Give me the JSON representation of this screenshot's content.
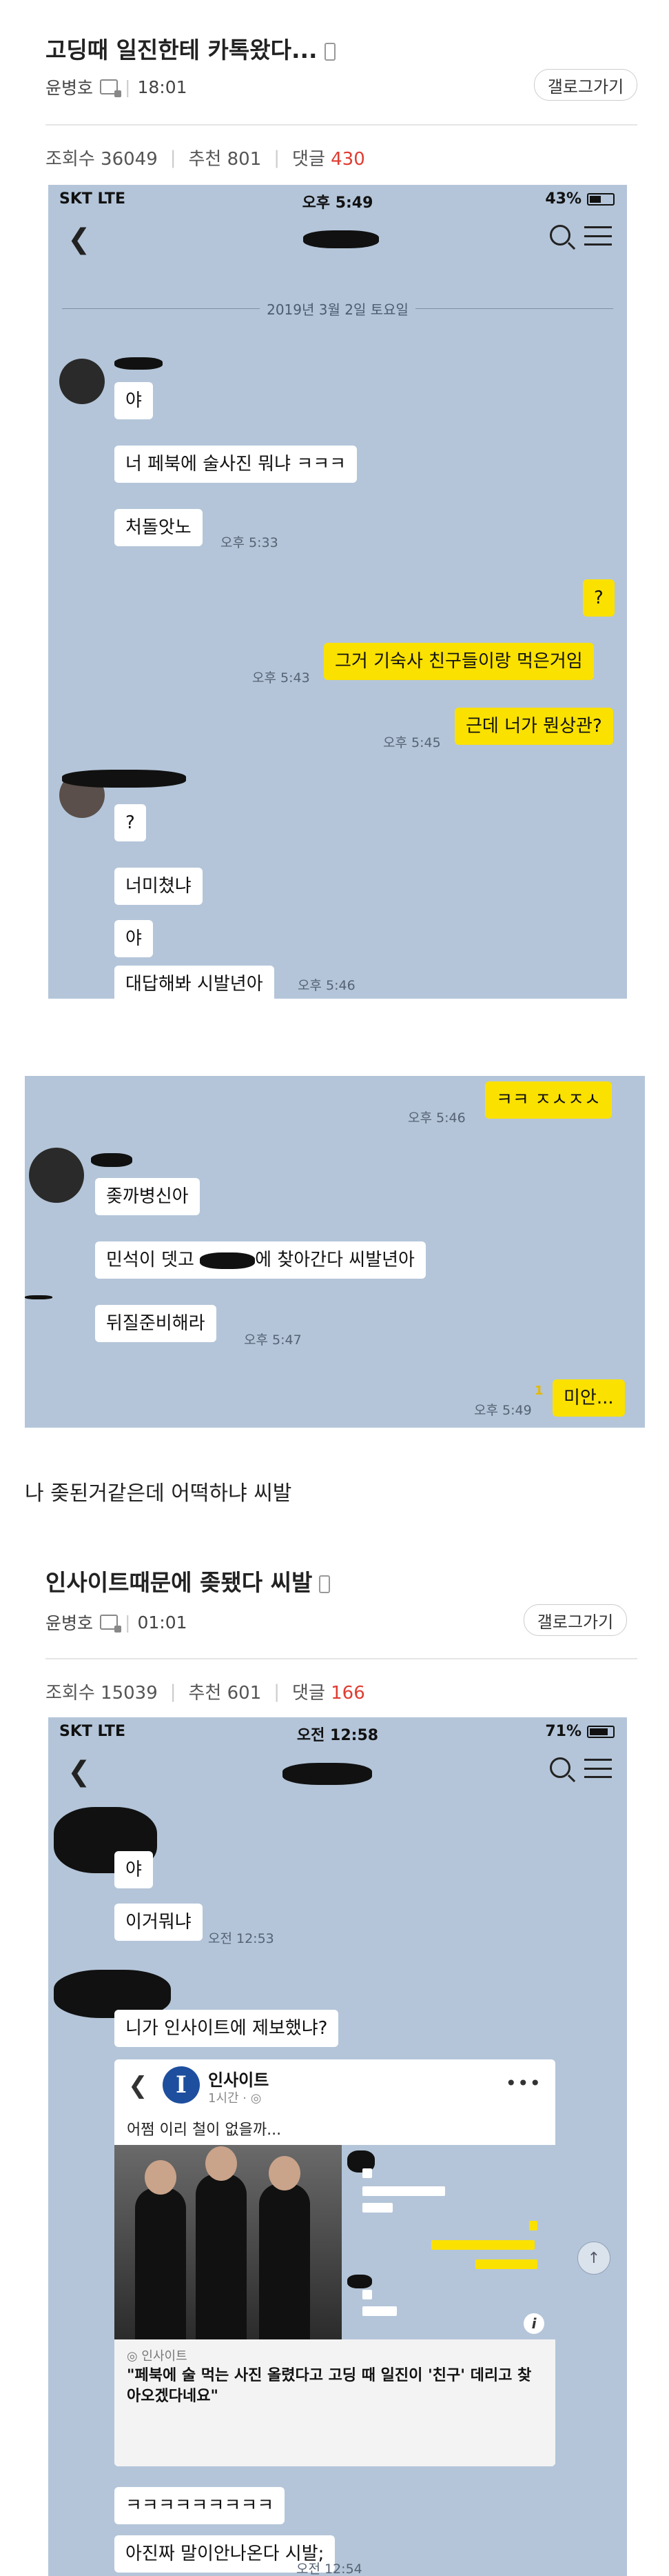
{
  "post1": {
    "title": "고딩때 일진한테 카톡왔다...",
    "author": "윤병호",
    "time": "18:01",
    "gallery_button": "갤로그가기",
    "views_label": "조회수",
    "views": "36049",
    "likes_label": "추천",
    "likes": "801",
    "comments_label": "댓글",
    "comments": "430"
  },
  "chat1": {
    "status": {
      "carrier": "SKT  LTE",
      "time": "오후 5:49",
      "battery": "43%"
    },
    "date_divider": "2019년 3월 2일 토요일",
    "msgs": {
      "m1": "야",
      "m2": "너 페북에 술사진 뭐냐 ㅋㅋㅋ",
      "m3": "처돌앗노",
      "t3": "오후 5:33",
      "m4": "?",
      "t5": "오후 5:43",
      "m5": "그거 기숙사 친구들이랑 먹은거임",
      "t6": "오후 5:45",
      "m6": "근데 너가 뭔상관?",
      "m7": "?",
      "m8": "너미쳤냐",
      "m9": "야",
      "m10": "대답해봐 시발년아",
      "t10": "오후 5:46"
    }
  },
  "chat2": {
    "msgs": {
      "t1": "오후 5:46",
      "m1": "ㅋㅋ ㅈㅅㅈㅅ",
      "m2": "좆까병신아",
      "m3a": "민석이 뎃고 ",
      "m3b": "에 찾아간다 씨발년아",
      "m4": "뒤질준비해라",
      "t4": "오후 5:47",
      "unread": "1",
      "t5": "오후 5:49",
      "m5": "미안..."
    }
  },
  "caption": "나 좆된거같은데 어떡하냐 씨발",
  "post2": {
    "title": "인사이트때문에 좆됐다 씨발",
    "author": "윤병호",
    "time": "01:01",
    "gallery_button": "갤로그가기",
    "views_label": "조회수",
    "views": "15039",
    "likes_label": "추천",
    "likes": "601",
    "comments_label": "댓글",
    "comments": "166"
  },
  "chat3": {
    "status": {
      "carrier": "SKT  LTE",
      "time": "오전 12:58",
      "battery": "71%"
    },
    "msgs": {
      "m1": "야",
      "m2": "이거뭐냐",
      "t2": "오전 12:53",
      "m3": "니가 인사이트에 제보했냐?",
      "m5": "ㅋㅋㅋㅋㅋㅋㅋㅋㅋ",
      "m6": "아진짜 말이안나온다 시발;",
      "t6": "오전 12:54"
    },
    "card": {
      "logo_letter": "I",
      "name": "인사이트",
      "time": "1시간 · ",
      "caption": "어쩜 이리 철이 없을까...",
      "source": "◎ 인사이트",
      "headline": "\"페북에 술 먹는 사진 올렸다고 고딩 때 일진이 '친구' 데리고 찾아오겠다네요\""
    }
  },
  "colors": {
    "chat_bg": "#b4c5d9",
    "my_bubble": "#fae100",
    "red_count": "#e03c31"
  }
}
